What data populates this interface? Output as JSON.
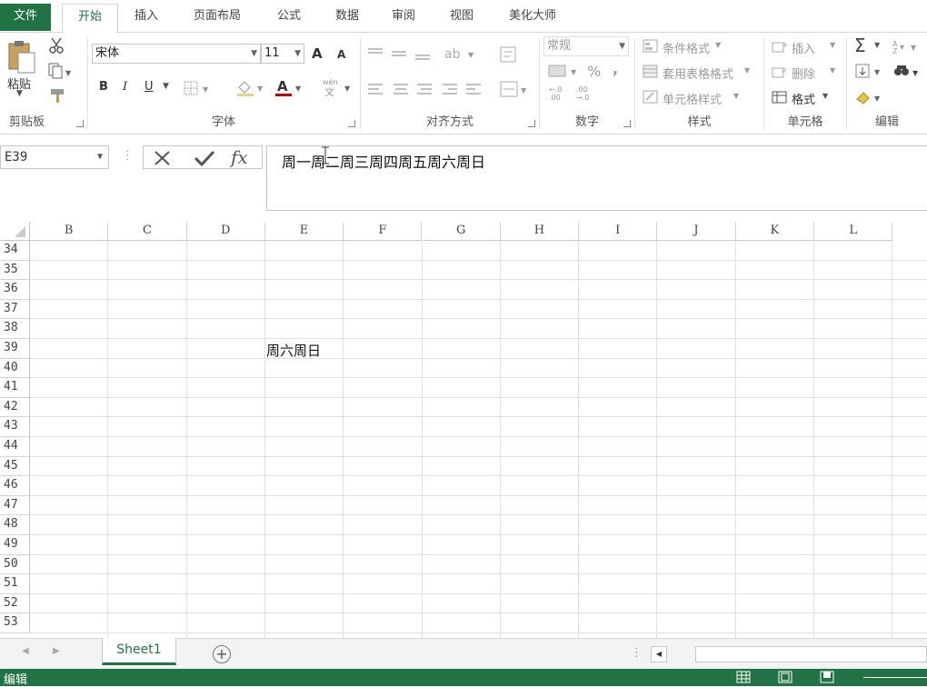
{
  "tabs": {
    "file": "文件",
    "home": "开始",
    "insert": "插入",
    "page_layout": "页面布局",
    "formulas": "公式",
    "data": "数据",
    "review": "审阅",
    "view": "视图",
    "beautify": "美化大师"
  },
  "ribbon": {
    "clipboard": {
      "label": "剪贴板",
      "paste": "粘贴"
    },
    "font": {
      "label": "字体",
      "font_name": "宋体",
      "font_size": "11",
      "bold": "B",
      "italic": "I",
      "underline": "U",
      "grow": "A",
      "shrink": "A",
      "font_color": "A",
      "phonetic": "wén\n文"
    },
    "alignment": {
      "label": "对齐方式"
    },
    "number": {
      "label": "数字",
      "format": "常规",
      "percent": "%",
      "comma": ",",
      "inc_decimal": "←.0\n.00",
      "dec_decimal": ".00\n→.0"
    },
    "styles": {
      "label": "样式",
      "conditional": "条件格式",
      "table": "套用表格格式",
      "cell_styles": "单元格样式"
    },
    "cells": {
      "label": "单元格",
      "insert": "插入",
      "delete": "删除",
      "format": "格式"
    },
    "editing": {
      "label": "编辑",
      "sum": "Σ"
    }
  },
  "formula_bar": {
    "name_box": "E39",
    "formula": "周一周二周三周四周五周六周日",
    "fx": "fx"
  },
  "grid": {
    "columns": [
      "B",
      "C",
      "D",
      "E",
      "F",
      "G",
      "H",
      "I",
      "J",
      "K",
      "L"
    ],
    "rows": [
      "34",
      "35",
      "36",
      "37",
      "38",
      "39",
      "40",
      "41",
      "42",
      "43",
      "44",
      "45",
      "46",
      "47",
      "48",
      "49",
      "50",
      "51",
      "52",
      "53"
    ],
    "visible_cell_text": "周六周日"
  },
  "sheets": {
    "active": "Sheet1",
    "add": "+"
  },
  "status": {
    "mode": "编辑"
  },
  "colors": {
    "accent": "#217346"
  }
}
